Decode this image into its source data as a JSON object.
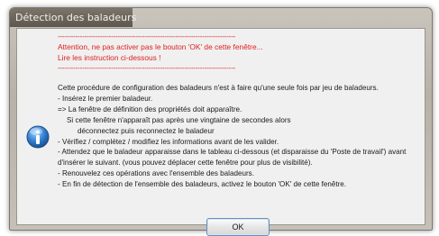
{
  "window": {
    "title": "Détection des baladeurs"
  },
  "warning": {
    "rule": "--------------------------------------------------------------------------------",
    "line1": "Attention, ne pas activer pas le bouton 'OK' de cette fenêtre...",
    "line2": "Lire les instruction ci-dessous !"
  },
  "instructions": [
    "Cette procédure de configuration des baladeurs n'est à faire qu'une seule fois par jeu de baladeurs.",
    "- Insérez le premier baladeur.",
    "=> La fenêtre de définition des propriétés doit apparaître.",
    "Si cette fenêtre n'apparaît pas après une vingtaine de secondes alors",
    "déconnectez puis reconnectez le baladeur",
    "- Vérifiez / complétez / modifiez les informations avant de les valider.",
    "- Attendez que le baladeur apparaisse dans le tableau ci-dessous (et disparaisse du 'Poste de travail') avant",
    "d'insérer le suivant. (vous pouvez déplacer cette fenêtre pour plus de visibilité).",
    "- Renouvelez ces opérations avec l'ensemble des baladeurs.",
    "- En fin de détection de l'ensemble des baladeurs, activez le bouton 'OK' de cette fenêtre."
  ],
  "buttons": {
    "ok": "OK"
  },
  "icons": {
    "info": "info-icon"
  },
  "colors": {
    "warning_text": "#e02020",
    "info_icon": "#2f7fd0"
  }
}
